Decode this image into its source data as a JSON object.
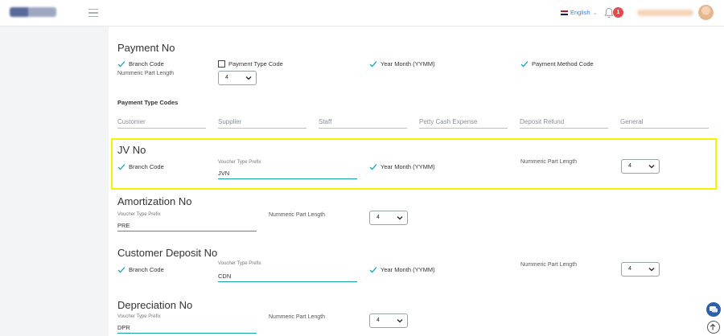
{
  "header": {
    "language": "English",
    "notification_count": "1"
  },
  "payment_no": {
    "title": "Payment No",
    "branch_code": "Branch Code",
    "payment_type_code": "Payment Type Code",
    "year_month": "Year Month (YYMM)",
    "payment_method_code": "Payment Method Code",
    "numeric_part_length_label": "Nummeric Part Length",
    "numeric_part_length_value": "4",
    "payment_type_codes_label": "Payment Type Codes",
    "codes": [
      "Customer",
      "Supplier",
      "Staff",
      "Petty Cash Expense",
      "Deposit Refund",
      "General"
    ]
  },
  "jv_no": {
    "title": "JV No",
    "branch_code": "Branch Code",
    "voucher_prefix_label": "Voucher Type Prefix",
    "voucher_prefix_value": "JVN",
    "year_month": "Year Month (YYMM)",
    "numeric_part_length_label": "Nummeric Part Length",
    "numeric_part_length_value": "4"
  },
  "amortization_no": {
    "title": "Amortization No",
    "voucher_prefix_label": "Voucher Type Prefix",
    "voucher_prefix_value": "PRE",
    "numeric_part_length_label": "Nummeric Part Length",
    "numeric_part_length_value": "4"
  },
  "customer_deposit_no": {
    "title": "Customer Deposit No",
    "branch_code": "Branch Code",
    "voucher_prefix_label": "Voucher Type Prefix",
    "voucher_prefix_value": "CDN",
    "year_month": "Year Month (YYMM)",
    "numeric_part_length_label": "Nummeric Part Length",
    "numeric_part_length_value": "4"
  },
  "depreciation_no": {
    "title": "Depreciation No",
    "voucher_prefix_label": "Voucher Type Prefix",
    "voucher_prefix_value": "DPR",
    "numeric_part_length_label": "Nummeric Part Length",
    "numeric_part_length_value": "4"
  },
  "icons": {
    "check": "check-icon",
    "bell": "bell-icon",
    "chat": "chat-icon",
    "scroll_top": "arrow-up-icon",
    "menu": "hamburger-icon"
  },
  "colors": {
    "accent": "#17a2b8",
    "highlight": "#f5f500",
    "badge": "#e5484d"
  }
}
